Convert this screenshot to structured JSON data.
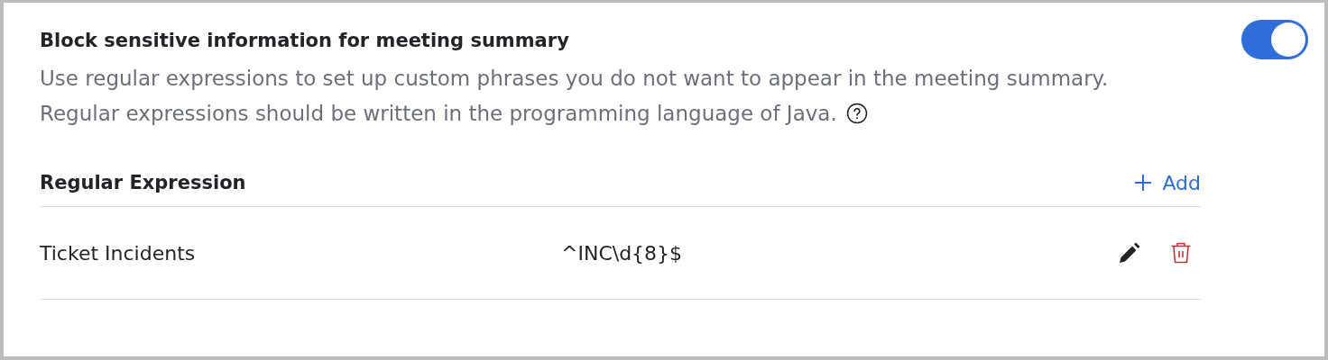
{
  "setting": {
    "title": "Block sensitive information for meeting summary",
    "enabled": true,
    "description": [
      "Use regular expressions to set up custom phrases you do not want to appear in the meeting summary.",
      "Regular expressions should be written in the programming language of Java."
    ]
  },
  "table": {
    "heading": "Regular Expression",
    "add_label": "Add",
    "rows": [
      {
        "name": "Ticket Incidents",
        "pattern": "^INC\\d{8}$"
      }
    ]
  }
}
